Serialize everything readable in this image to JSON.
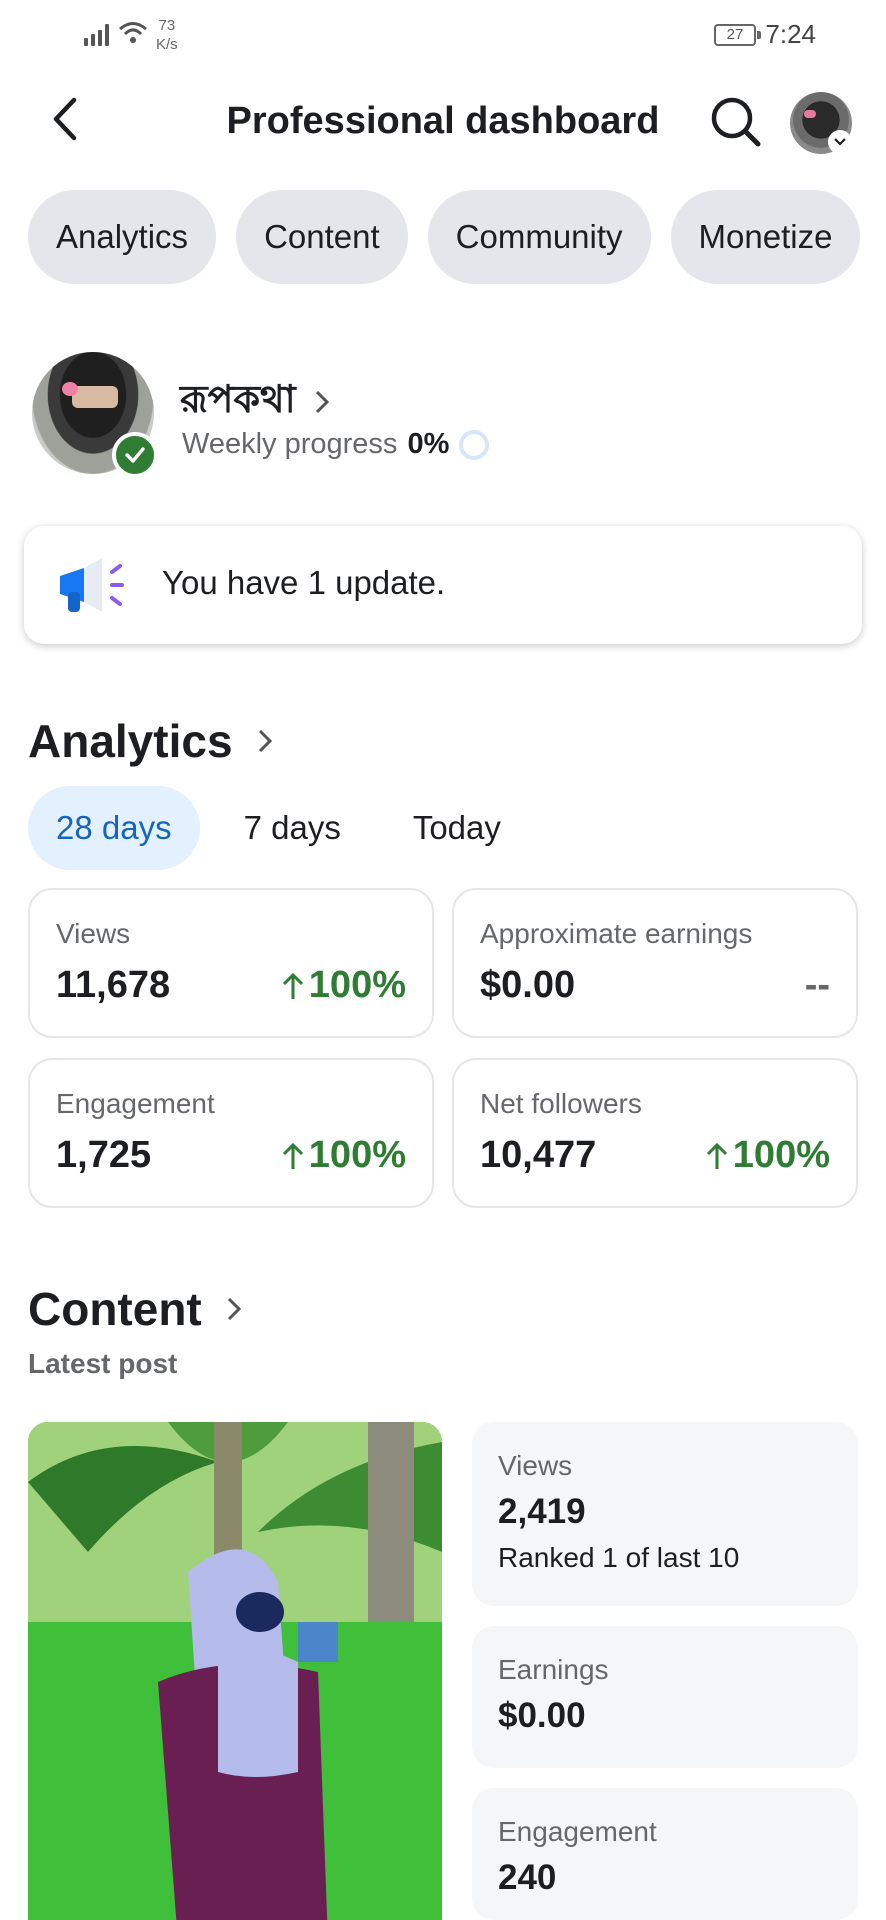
{
  "status_bar": {
    "net_speed_value": "73",
    "net_speed_unit": "K/s",
    "battery": "27",
    "time": "7:24"
  },
  "header": {
    "title": "Professional dashboard",
    "icons": [
      "back-arrow-icon",
      "search-icon",
      "avatar",
      "chevron-down-icon"
    ]
  },
  "tabs": [
    {
      "label": "Analytics"
    },
    {
      "label": "Content"
    },
    {
      "label": "Community"
    },
    {
      "label": "Monetize"
    }
  ],
  "profile": {
    "name": "রূপকথা",
    "progress_label": "Weekly progress",
    "progress_value": "0%",
    "progress_fraction": 0
  },
  "update_card": {
    "text": "You have 1 update."
  },
  "analytics": {
    "heading": "Analytics",
    "periods": [
      {
        "label": "28 days",
        "active": true
      },
      {
        "label": "7 days",
        "active": false
      },
      {
        "label": "Today",
        "active": false
      }
    ],
    "stats": [
      {
        "label": "Views",
        "value": "11,678",
        "change": "100%"
      },
      {
        "label": "Approximate earnings",
        "value": "$0.00",
        "change": "--"
      },
      {
        "label": "Engagement",
        "value": "1,725",
        "change": "100%"
      },
      {
        "label": "Net followers",
        "value": "10,477",
        "change": "100%"
      }
    ]
  },
  "content": {
    "heading": "Content",
    "subheading": "Latest post",
    "metrics": [
      {
        "label": "Views",
        "value": "2,419",
        "note": "Ranked 1 of last 10"
      },
      {
        "label": "Earnings",
        "value": "$0.00"
      },
      {
        "label": "Engagement",
        "value": "240"
      }
    ]
  },
  "colors": {
    "positive": "#2e7d32",
    "active_pill_bg": "#e3f0fd",
    "active_pill_text": "#1565c0",
    "pill_bg": "#e4e6eb"
  }
}
